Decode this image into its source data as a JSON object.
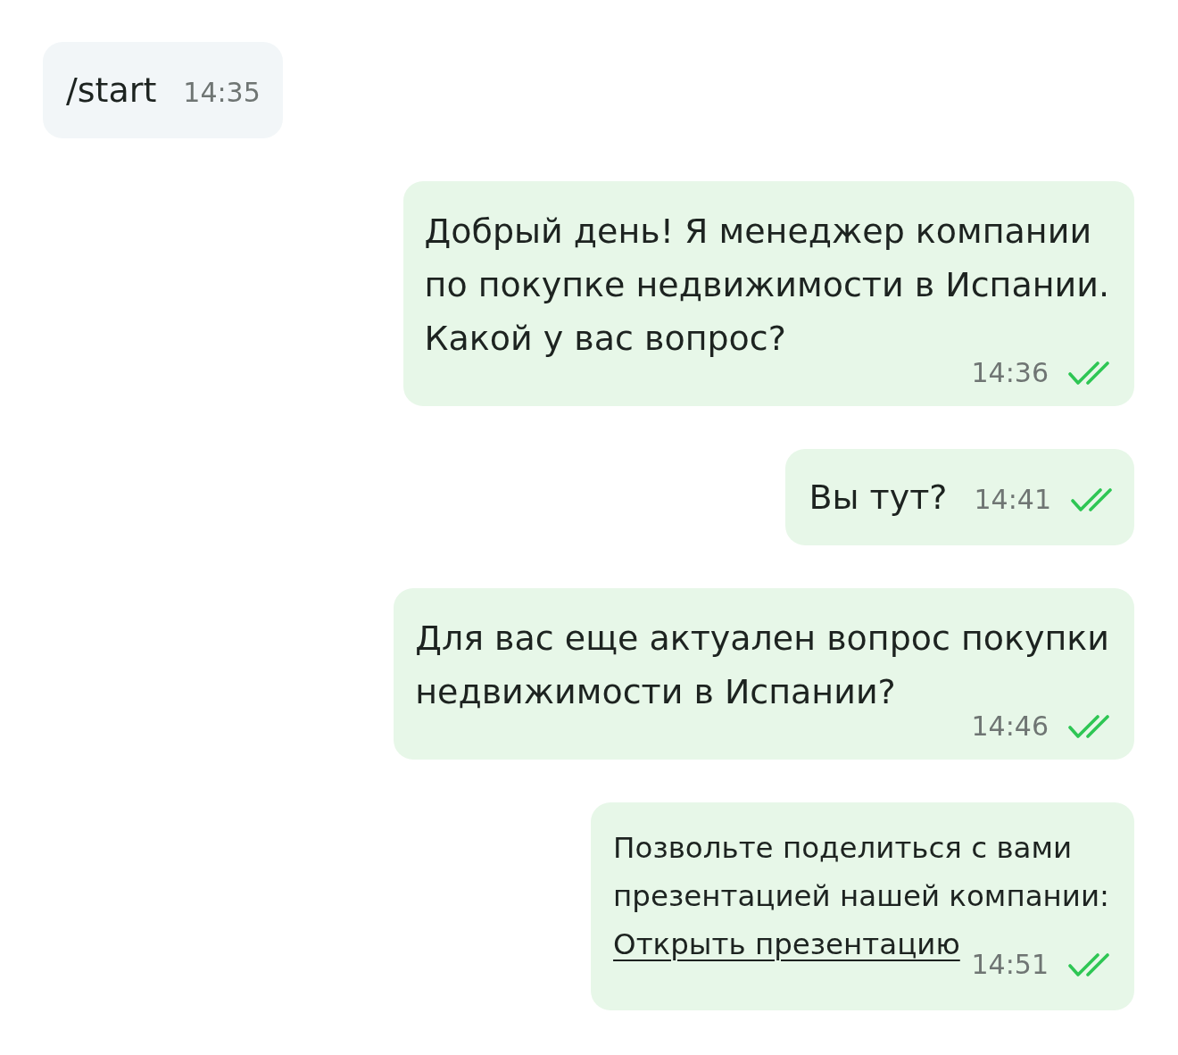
{
  "messages": [
    {
      "kind": "incoming",
      "text": "/start",
      "time": "14:35"
    },
    {
      "kind": "outgoing",
      "text": "Добрый день! Я менеджер компании\nпо покупке недвижимости в Испании.\nКакой у вас вопрос?",
      "time": "14:36",
      "read": true
    },
    {
      "kind": "outgoing",
      "text": "Вы тут?",
      "time": "14:41",
      "read": true
    },
    {
      "kind": "outgoing",
      "text": "Для вас еще актуален вопрос покупки\nнедвижимости в Испании?",
      "time": "14:46",
      "read": true
    },
    {
      "kind": "outgoing",
      "text": "Позвольте поделиться с вами\nпрезентацией нашей компании:",
      "link": "Открыть презентацию",
      "time": "14:51",
      "read": true
    }
  ]
}
